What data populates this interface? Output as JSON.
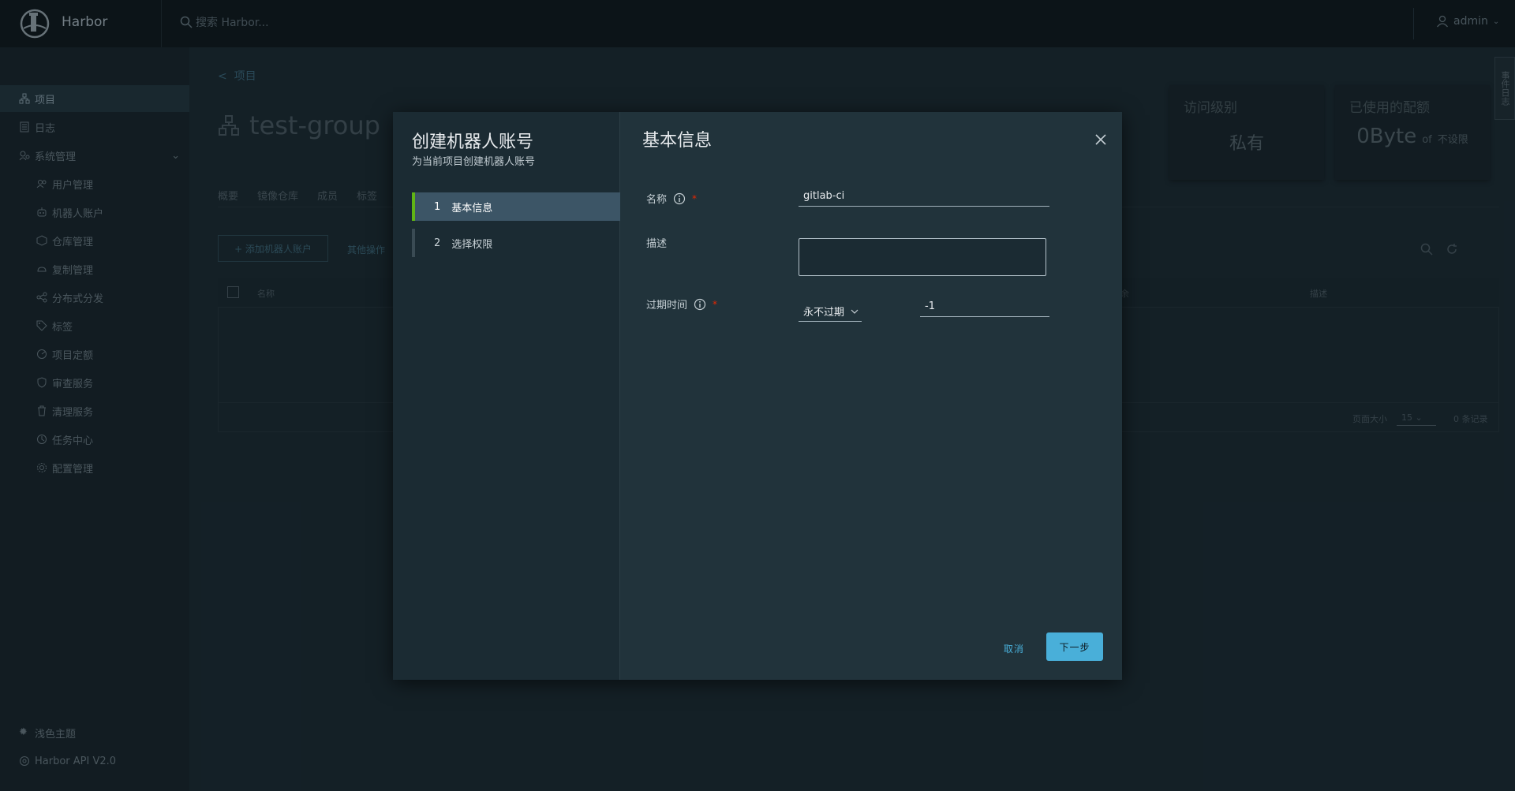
{
  "header": {
    "brand": "Harbor",
    "search_placeholder": "搜索 Harbor...",
    "user": "admin"
  },
  "sidebar": {
    "items": [
      {
        "label": "项目",
        "icon": "project-icon"
      },
      {
        "label": "日志",
        "icon": "log-icon"
      },
      {
        "label": "系统管理",
        "icon": "admin-icon"
      },
      {
        "label": "用户管理",
        "icon": "users-icon"
      },
      {
        "label": "机器人账户",
        "icon": "robot-icon"
      },
      {
        "label": "仓库管理",
        "icon": "registry-icon"
      },
      {
        "label": "复制管理",
        "icon": "replication-icon"
      },
      {
        "label": "分布式分发",
        "icon": "distribution-icon"
      },
      {
        "label": "标签",
        "icon": "tag-icon"
      },
      {
        "label": "项目定额",
        "icon": "quota-icon"
      },
      {
        "label": "审查服务",
        "icon": "scanner-icon"
      },
      {
        "label": "清理服务",
        "icon": "trash-icon"
      },
      {
        "label": "任务中心",
        "icon": "job-icon"
      },
      {
        "label": "配置管理",
        "icon": "config-icon"
      }
    ],
    "theme": "浅色主题",
    "api": "Harbor API V2.0"
  },
  "page": {
    "back": "项目",
    "title": "test-group",
    "access_level_label": "访问级别",
    "access_level_value": "私有",
    "quota_label": "已使用的配额",
    "quota_value": "0Byte",
    "quota_of": "of",
    "quota_limit": "不设限",
    "tabs": [
      "概要",
      "镜像仓库",
      "成员",
      "标签"
    ],
    "add_robot": "+ 添加机器人账户",
    "other_ops": "其他操作",
    "col_name": "名称",
    "col_desc": "描述",
    "col_mid": "余",
    "page_size_label": "页面大小",
    "page_size": "15",
    "records": "0 条记录",
    "side_tab": "事件日志"
  },
  "modal": {
    "title": "创建机器人账号",
    "subtitle": "为当前项目创建机器人账号",
    "steps": [
      {
        "num": "1",
        "label": "基本信息"
      },
      {
        "num": "2",
        "label": "选择权限"
      }
    ],
    "content_title": "基本信息",
    "name_label": "名称",
    "name_value": "gitlab-ci",
    "desc_label": "描述",
    "expire_label": "过期时间",
    "expire_select": "永不过期",
    "expire_value": "-1",
    "required_mark": "*",
    "cancel": "取消",
    "next": "下一步"
  },
  "colors": {
    "accent": "#49afd9",
    "step_marker": "#60b515",
    "required": "#e62700"
  }
}
